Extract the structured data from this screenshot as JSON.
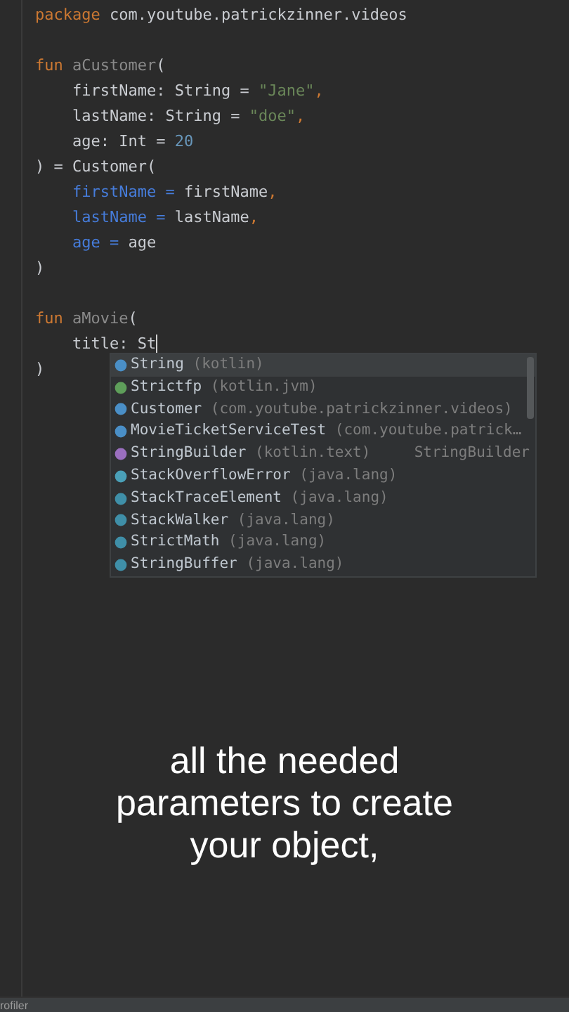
{
  "editor": {
    "blocks": [
      [
        [
          {
            "text": "package",
            "kind": "kw"
          },
          {
            "text": " com.youtube.patrickzinner.videos",
            "kind": "plain"
          }
        ]
      ],
      [
        [
          {
            "text": "fun",
            "kind": "kw"
          },
          {
            "text": " aCustomer",
            "kind": "fn"
          },
          {
            "text": "(",
            "kind": "plain"
          }
        ],
        [
          {
            "text": "    firstName: String = ",
            "kind": "plain"
          },
          {
            "text": "\"Jane\"",
            "kind": "str"
          },
          {
            "text": ",",
            "kind": "kw"
          }
        ],
        [
          {
            "text": "    lastName: String = ",
            "kind": "plain"
          },
          {
            "text": "\"doe\"",
            "kind": "str"
          },
          {
            "text": ",",
            "kind": "kw"
          }
        ],
        [
          {
            "text": "    age: Int = ",
            "kind": "plain"
          },
          {
            "text": "20",
            "kind": "num"
          }
        ],
        [
          {
            "text": ") = Customer(",
            "kind": "plain"
          }
        ],
        [
          {
            "text": "    firstName",
            "kind": "param"
          },
          {
            "text": " = ",
            "kind": "param"
          },
          {
            "text": "firstName",
            "kind": "plain"
          },
          {
            "text": ",",
            "kind": "kw"
          }
        ],
        [
          {
            "text": "    lastName",
            "kind": "param"
          },
          {
            "text": " = ",
            "kind": "param"
          },
          {
            "text": "lastName",
            "kind": "plain"
          },
          {
            "text": ",",
            "kind": "kw"
          }
        ],
        [
          {
            "text": "    age",
            "kind": "param"
          },
          {
            "text": " = ",
            "kind": "param"
          },
          {
            "text": "age",
            "kind": "plain"
          }
        ],
        [
          {
            "text": ")",
            "kind": "plain"
          }
        ]
      ],
      [
        [
          {
            "text": "fun",
            "kind": "kw"
          },
          {
            "text": " aMovie",
            "kind": "fn"
          },
          {
            "text": "(",
            "kind": "plain"
          }
        ],
        [
          {
            "text": "    title: St",
            "kind": "plain"
          }
        ],
        [
          {
            "text": ")",
            "kind": "plain"
          }
        ]
      ]
    ]
  },
  "completion": {
    "items": [
      {
        "name": "String",
        "package": "(kotlin)",
        "kind": "class",
        "selected": true
      },
      {
        "name": "Strictfp",
        "package": "(kotlin.jvm)",
        "kind": "annotation",
        "selected": false
      },
      {
        "name": "Customer",
        "package": "(com.youtube.patrickzinner.videos)",
        "kind": "class",
        "selected": false
      },
      {
        "name": "MovieTicketServiceTest",
        "package": "(com.youtube.patrick…",
        "kind": "class",
        "selected": false
      },
      {
        "name": "StringBuilder",
        "package": "(kotlin.text)",
        "type_hint": "StringBuilder",
        "kind": "alias",
        "selected": false
      },
      {
        "name": "StackOverflowError",
        "package": "(java.lang)",
        "kind": "exception",
        "selected": false
      },
      {
        "name": "StackTraceElement",
        "package": "(java.lang)",
        "kind": "java",
        "selected": false
      },
      {
        "name": "StackWalker",
        "package": "(java.lang)",
        "kind": "java",
        "selected": false
      },
      {
        "name": "StrictMath",
        "package": "(java.lang)",
        "kind": "java",
        "selected": false
      },
      {
        "name": "StringBuffer",
        "package": "(java.lang)",
        "kind": "java",
        "selected": false
      }
    ]
  },
  "caption": "all the needed parameters to create your object,",
  "status_bar": {
    "tool": "rofiler"
  }
}
